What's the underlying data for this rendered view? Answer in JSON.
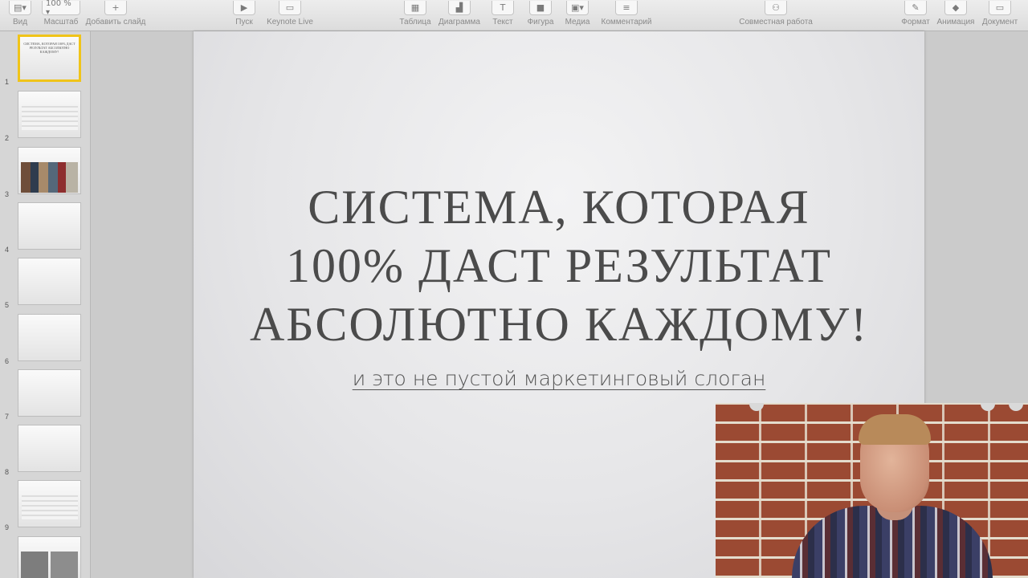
{
  "toolbar": {
    "items": [
      {
        "label": "Вид",
        "icon": "view-icon",
        "glyph": "▤▾"
      },
      {
        "label": "Масштаб",
        "icon": "zoom-select",
        "glyph": "100 % ▾"
      },
      {
        "label": "Добавить слайд",
        "icon": "plus-icon",
        "glyph": "+"
      },
      {
        "label": "Пуск",
        "icon": "play-icon",
        "glyph": "▶"
      },
      {
        "label": "Keynote Live",
        "icon": "keynote-live-icon",
        "glyph": "▭"
      },
      {
        "label": "Таблица",
        "icon": "table-icon",
        "glyph": "▦"
      },
      {
        "label": "Диаграмма",
        "icon": "chart-icon",
        "glyph": "▟"
      },
      {
        "label": "Текст",
        "icon": "text-icon",
        "glyph": "T"
      },
      {
        "label": "Фигура",
        "icon": "shape-icon",
        "glyph": "■"
      },
      {
        "label": "Медиа",
        "icon": "media-icon",
        "glyph": "▣▾"
      },
      {
        "label": "Комментарий",
        "icon": "comment-icon",
        "glyph": "≡"
      },
      {
        "label": "Совместная работа",
        "icon": "collaborate-icon",
        "glyph": "⚇"
      },
      {
        "label": "Формат",
        "icon": "format-icon",
        "glyph": "✎"
      },
      {
        "label": "Анимация",
        "icon": "animation-icon",
        "glyph": "◆"
      },
      {
        "label": "Документ",
        "icon": "document-icon",
        "glyph": "▭"
      }
    ]
  },
  "sidebar": {
    "slides": [
      {
        "number": "1",
        "text": "Система, которая 100% даст результат абсолютно каждому!",
        "selected": true,
        "kind": "text"
      },
      {
        "number": "2",
        "text": "",
        "selected": false,
        "kind": "dash"
      },
      {
        "number": "3",
        "text": "",
        "selected": false,
        "kind": "photos"
      },
      {
        "number": "4",
        "text": "",
        "selected": false,
        "kind": "text"
      },
      {
        "number": "5",
        "text": "",
        "selected": false,
        "kind": "text"
      },
      {
        "number": "6",
        "text": "",
        "selected": false,
        "kind": "text"
      },
      {
        "number": "7",
        "text": "",
        "selected": false,
        "kind": "text"
      },
      {
        "number": "8",
        "text": "",
        "selected": false,
        "kind": "text"
      },
      {
        "number": "9",
        "text": "",
        "selected": false,
        "kind": "text"
      },
      {
        "number": "",
        "text": "",
        "selected": false,
        "kind": "gray"
      }
    ]
  },
  "slide": {
    "title_lines": [
      "СИСТЕМА, КОТОРАЯ",
      "100% ДАСТ РЕЗУЛЬТАТ",
      "АБСОЛЮТНО КАЖДОМУ!"
    ],
    "subtitle": "и это не пустой маркетинговый слоган"
  },
  "colors": {
    "selection": "#f0c419",
    "title": "#4b4b4b",
    "brick": "#9b4a33"
  }
}
